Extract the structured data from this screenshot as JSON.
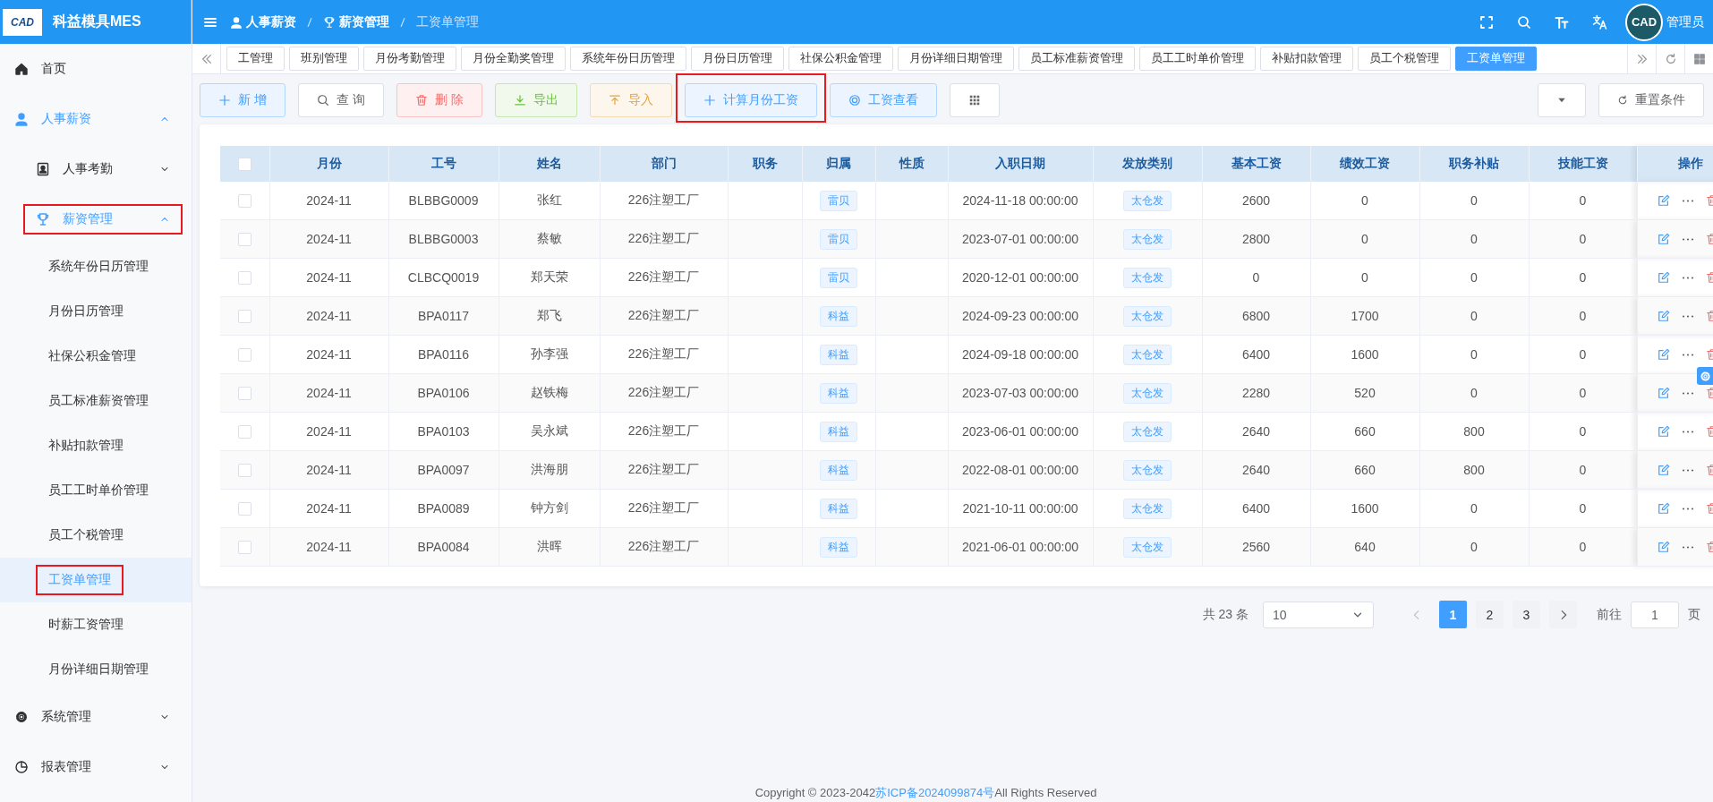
{
  "logo": {
    "text": "CAD",
    "brand": "科益模具MES"
  },
  "breadcrumb": [
    {
      "label": "人事薪资"
    },
    {
      "label": "薪资管理"
    },
    {
      "label": "工资单管理"
    }
  ],
  "user": {
    "avatar_text": "CAD",
    "name": "管理员"
  },
  "sidebar": {
    "items": [
      {
        "label": "首页",
        "selected": false
      },
      {
        "label": "人事薪资",
        "expanded": true,
        "children": [
          {
            "label": "人事考勤",
            "expanded": false,
            "highlighted": false
          },
          {
            "label": "薪资管理",
            "expanded": true,
            "highlighted": true,
            "children": [
              {
                "label": "系统年份日历管理",
                "selected": false,
                "highlighted": false
              },
              {
                "label": "月份日历管理",
                "selected": false,
                "highlighted": false
              },
              {
                "label": "社保公积金管理",
                "selected": false,
                "highlighted": false
              },
              {
                "label": "员工标准薪资管理",
                "selected": false,
                "highlighted": false
              },
              {
                "label": "补贴扣款管理",
                "selected": false,
                "highlighted": false
              },
              {
                "label": "员工工时单价管理",
                "selected": false,
                "highlighted": false
              },
              {
                "label": "员工个税管理",
                "selected": false,
                "highlighted": false
              },
              {
                "label": "工资单管理",
                "selected": true,
                "highlighted": true
              },
              {
                "label": "时薪工资管理",
                "selected": false,
                "highlighted": false
              },
              {
                "label": "月份详细日期管理",
                "selected": false,
                "highlighted": false
              }
            ]
          }
        ]
      },
      {
        "label": "系统管理",
        "expanded": false
      },
      {
        "label": "报表管理",
        "expanded": false
      }
    ]
  },
  "tabs": [
    {
      "label": "工管理",
      "selected": false
    },
    {
      "label": "班别管理",
      "selected": false
    },
    {
      "label": "月份考勤管理",
      "selected": false
    },
    {
      "label": "月份全勤奖管理",
      "selected": false
    },
    {
      "label": "系统年份日历管理",
      "selected": false
    },
    {
      "label": "月份日历管理",
      "selected": false
    },
    {
      "label": "社保公积金管理",
      "selected": false
    },
    {
      "label": "月份详细日期管理",
      "selected": false
    },
    {
      "label": "员工标准薪资管理",
      "selected": false
    },
    {
      "label": "员工工时单价管理",
      "selected": false
    },
    {
      "label": "补贴扣款管理",
      "selected": false
    },
    {
      "label": "员工个税管理",
      "selected": false
    },
    {
      "label": "工资单管理",
      "selected": true
    }
  ],
  "toolbar": [
    {
      "kind": "add",
      "label": "新 增",
      "highlighted": false
    },
    {
      "kind": "query",
      "label": "查 询",
      "highlighted": false
    },
    {
      "kind": "delete",
      "label": "删 除",
      "highlighted": false
    },
    {
      "kind": "export",
      "label": "导出",
      "highlighted": false
    },
    {
      "kind": "import",
      "label": "导入",
      "highlighted": false
    },
    {
      "kind": "calc",
      "label": "计算月份工资",
      "highlighted": true
    },
    {
      "kind": "view",
      "label": "工资查看",
      "highlighted": false
    },
    {
      "kind": "grid",
      "highlighted": false
    }
  ],
  "toolbar_right": [
    {
      "kind": "dropdown"
    },
    {
      "kind": "reset",
      "label": "重置条件"
    }
  ],
  "table": {
    "all_selected": false,
    "columns": [
      {
        "kind": "check"
      },
      {
        "kind": "text",
        "label": "月份"
      },
      {
        "kind": "text",
        "label": "工号"
      },
      {
        "kind": "text",
        "label": "姓名"
      },
      {
        "kind": "text",
        "label": "部门"
      },
      {
        "kind": "text",
        "label": "职务"
      },
      {
        "kind": "tag",
        "label": "归属"
      },
      {
        "kind": "text",
        "label": "性质"
      },
      {
        "kind": "text",
        "label": "入职日期"
      },
      {
        "kind": "tag",
        "label": "发放类别"
      },
      {
        "kind": "text",
        "label": "基本工资"
      },
      {
        "kind": "text",
        "label": "绩效工资"
      },
      {
        "kind": "text",
        "label": "职务补贴"
      },
      {
        "kind": "text",
        "label": "技能工资"
      },
      {
        "kind": "actions",
        "label": "操作"
      }
    ],
    "rows": [
      {
        "selected": false,
        "cells": [
          "",
          "2024-11",
          "BLBBG0009",
          "张红",
          "226注塑工厂",
          "",
          "雷贝",
          "",
          "2024-11-18 00:00:00",
          "太仓发",
          "2600",
          "0",
          "0",
          "0"
        ]
      },
      {
        "selected": false,
        "cells": [
          "",
          "2024-11",
          "BLBBG0003",
          "蔡敏",
          "226注塑工厂",
          "",
          "雷贝",
          "",
          "2023-07-01 00:00:00",
          "太仓发",
          "2800",
          "0",
          "0",
          "0"
        ]
      },
      {
        "selected": false,
        "cells": [
          "",
          "2024-11",
          "CLBCQ0019",
          "郑天荣",
          "226注塑工厂",
          "",
          "雷贝",
          "",
          "2020-12-01 00:00:00",
          "太仓发",
          "0",
          "0",
          "0",
          "0"
        ]
      },
      {
        "selected": false,
        "cells": [
          "",
          "2024-11",
          "BPA0117",
          "郑飞",
          "226注塑工厂",
          "",
          "科益",
          "",
          "2024-09-23 00:00:00",
          "太仓发",
          "6800",
          "1700",
          "0",
          "0"
        ]
      },
      {
        "selected": false,
        "cells": [
          "",
          "2024-11",
          "BPA0116",
          "孙李强",
          "226注塑工厂",
          "",
          "科益",
          "",
          "2024-09-18 00:00:00",
          "太仓发",
          "6400",
          "1600",
          "0",
          "0"
        ]
      },
      {
        "selected": false,
        "cells": [
          "",
          "2024-11",
          "BPA0106",
          "赵铁梅",
          "226注塑工厂",
          "",
          "科益",
          "",
          "2023-07-03 00:00:00",
          "太仓发",
          "2280",
          "520",
          "0",
          "0"
        ]
      },
      {
        "selected": false,
        "cells": [
          "",
          "2024-11",
          "BPA0103",
          "吴永斌",
          "226注塑工厂",
          "",
          "科益",
          "",
          "2023-06-01 00:00:00",
          "太仓发",
          "2640",
          "660",
          "800",
          "0"
        ]
      },
      {
        "selected": false,
        "cells": [
          "",
          "2024-11",
          "BPA0097",
          "洪海朋",
          "226注塑工厂",
          "",
          "科益",
          "",
          "2022-08-01 00:00:00",
          "太仓发",
          "2640",
          "660",
          "800",
          "0"
        ]
      },
      {
        "selected": false,
        "cells": [
          "",
          "2024-11",
          "BPA0089",
          "钟方剑",
          "226注塑工厂",
          "",
          "科益",
          "",
          "2021-10-11 00:00:00",
          "太仓发",
          "6400",
          "1600",
          "0",
          "0"
        ]
      },
      {
        "selected": false,
        "cells": [
          "",
          "2024-11",
          "BPA0084",
          "洪晖",
          "226注塑工厂",
          "",
          "科益",
          "",
          "2021-06-01 00:00:00",
          "太仓发",
          "2560",
          "640",
          "0",
          "0"
        ]
      }
    ]
  },
  "pagination": {
    "total": "共 23 条",
    "page_size": "10",
    "pages": [
      {
        "label": "1",
        "selected": true
      },
      {
        "label": "2",
        "selected": false
      },
      {
        "label": "3",
        "selected": false
      }
    ],
    "goto_label": "前往",
    "goto_value": "1",
    "page_unit": "页"
  },
  "footer": {
    "before": "Copyright © 2023-2042",
    "link": "苏ICP备2024099874号",
    "after": "All Rights Reserved"
  }
}
